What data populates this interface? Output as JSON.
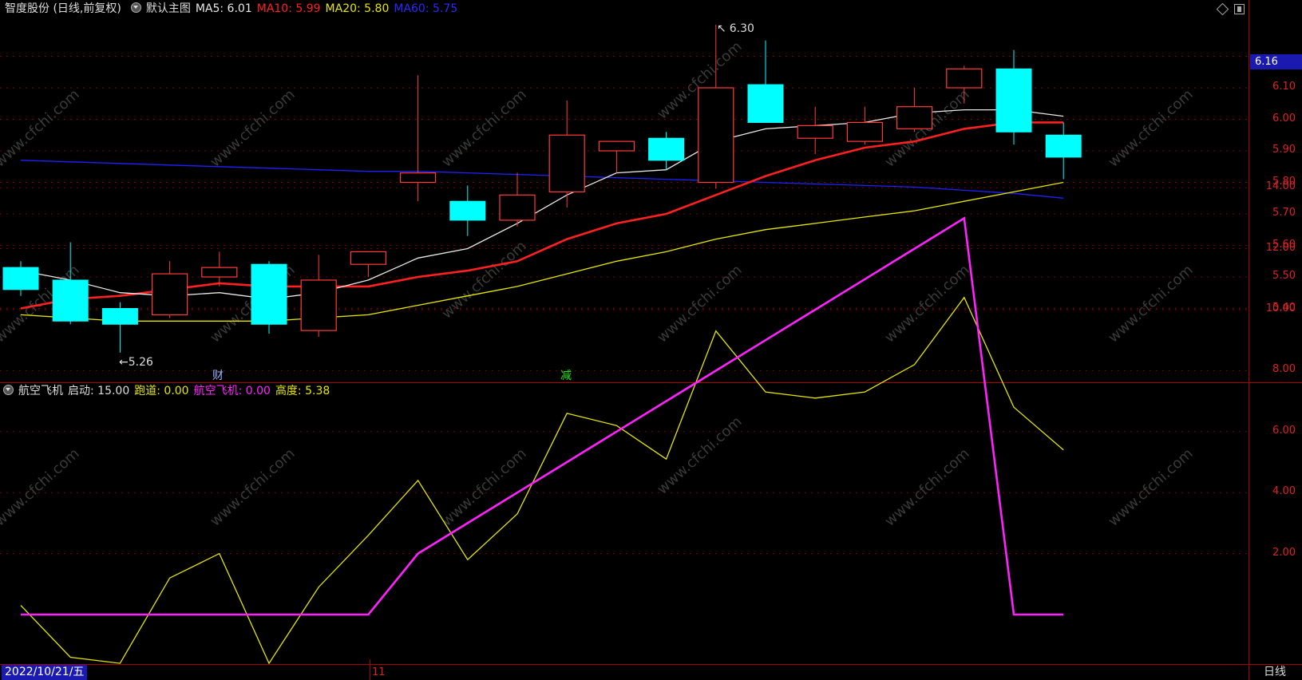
{
  "main_header": {
    "title": "智度股份 (日线,前复权)",
    "indicator_name": "默认主图",
    "ma5": "MA5: 6.01",
    "ma10": "MA10: 5.99",
    "ma20": "MA20: 5.80",
    "ma60": "MA60: 5.75"
  },
  "sub_header": {
    "name": "航空飞机",
    "start": "启动: 15.00",
    "runway": "跑道: 0.00",
    "plane": "航空飞机: 0.00",
    "height": "高度: 5.38"
  },
  "colors": {
    "up": "#ff3b3b",
    "down": "#00ffff",
    "ma5": "#e8e8e8",
    "ma10": "#ff2020",
    "ma20": "#e6e600",
    "ma60": "#2020ff",
    "plane": "#ff22ff",
    "height_line": "#e6e600"
  },
  "price_tag": "6.16",
  "date_label": "2022/10/21/五",
  "month_tick": "11",
  "period_label": "日线",
  "markers": {
    "cai": "财",
    "jian": "减",
    "high_label": "6.30",
    "low_label": "5.26"
  },
  "watermark": "www.cfchi.com",
  "chart_data": [
    {
      "type": "candlestick",
      "ylim": [
        5.2,
        6.25
      ],
      "y_ticks": [
        "6.10",
        "6.00",
        "5.90",
        "5.80",
        "5.70",
        "5.60",
        "5.50",
        "5.40"
      ],
      "candles": [
        {
          "o": 5.53,
          "h": 5.55,
          "l": 5.44,
          "c": 5.46
        },
        {
          "o": 5.49,
          "h": 5.61,
          "l": 5.35,
          "c": 5.36
        },
        {
          "o": 5.4,
          "h": 5.42,
          "l": 5.26,
          "c": 5.35
        },
        {
          "o": 5.38,
          "h": 5.55,
          "l": 5.37,
          "c": 5.51
        },
        {
          "o": 5.5,
          "h": 5.58,
          "l": 5.47,
          "c": 5.53
        },
        {
          "o": 5.54,
          "h": 5.55,
          "l": 5.32,
          "c": 5.35
        },
        {
          "o": 5.33,
          "h": 5.57,
          "l": 5.31,
          "c": 5.49
        },
        {
          "o": 5.54,
          "h": 5.58,
          "l": 5.5,
          "c": 5.58
        },
        {
          "o": 5.8,
          "h": 6.14,
          "l": 5.74,
          "c": 5.83
        },
        {
          "o": 5.74,
          "h": 5.79,
          "l": 5.63,
          "c": 5.68
        },
        {
          "o": 5.68,
          "h": 5.83,
          "l": 5.66,
          "c": 5.76
        },
        {
          "o": 5.77,
          "h": 6.06,
          "l": 5.72,
          "c": 5.95
        },
        {
          "o": 5.9,
          "h": 5.93,
          "l": 5.83,
          "c": 5.93
        },
        {
          "o": 5.94,
          "h": 5.96,
          "l": 5.84,
          "c": 5.87
        },
        {
          "o": 5.8,
          "h": 6.3,
          "l": 5.78,
          "c": 6.1
        },
        {
          "o": 6.11,
          "h": 6.25,
          "l": 5.99,
          "c": 5.99
        },
        {
          "o": 5.94,
          "h": 6.04,
          "l": 5.89,
          "c": 5.98
        },
        {
          "o": 5.93,
          "h": 6.04,
          "l": 5.92,
          "c": 5.99
        },
        {
          "o": 5.97,
          "h": 6.1,
          "l": 5.96,
          "c": 6.04
        },
        {
          "o": 6.1,
          "h": 6.17,
          "l": 6.05,
          "c": 6.16
        },
        {
          "o": 6.16,
          "h": 6.22,
          "l": 5.92,
          "c": 5.96
        },
        {
          "o": 5.95,
          "h": 5.99,
          "l": 5.81,
          "c": 5.88
        }
      ],
      "ma5": [
        5.52,
        5.49,
        5.45,
        5.44,
        5.45,
        5.43,
        5.45,
        5.49,
        5.56,
        5.59,
        5.67,
        5.76,
        5.83,
        5.84,
        5.93,
        5.97,
        5.98,
        5.99,
        6.02,
        6.03,
        6.03,
        6.01
      ],
      "ma10": [
        5.4,
        5.43,
        5.44,
        5.46,
        5.48,
        5.47,
        5.47,
        5.47,
        5.5,
        5.52,
        5.55,
        5.62,
        5.67,
        5.7,
        5.76,
        5.82,
        5.87,
        5.91,
        5.93,
        5.97,
        5.99,
        5.99
      ],
      "ma20": [
        5.38,
        5.37,
        5.36,
        5.36,
        5.36,
        5.36,
        5.37,
        5.38,
        5.41,
        5.44,
        5.47,
        5.51,
        5.55,
        5.58,
        5.62,
        5.65,
        5.67,
        5.69,
        5.71,
        5.74,
        5.77,
        5.8
      ],
      "ma60": [
        5.87,
        5.865,
        5.86,
        5.855,
        5.85,
        5.845,
        5.84,
        5.835,
        5.835,
        5.83,
        5.825,
        5.82,
        5.815,
        5.81,
        5.805,
        5.8,
        5.795,
        5.79,
        5.785,
        5.775,
        5.765,
        5.75
      ]
    },
    {
      "type": "line",
      "ylim": [
        0,
        15
      ],
      "y_ticks": [
        "14.00",
        "12.00",
        "10.00",
        "8.00",
        "6.00",
        "4.00",
        "2.00"
      ],
      "series": [
        {
          "name": "航空飞机",
          "values": [
            0,
            0,
            0,
            0,
            0,
            0,
            0,
            0,
            2,
            3,
            4,
            5,
            6,
            7,
            8,
            9,
            10,
            11,
            12,
            13,
            0,
            0
          ]
        },
        {
          "name": "高度",
          "values": [
            0.3,
            -1.4,
            -1.6,
            1.2,
            2.0,
            -1.6,
            0.9,
            2.6,
            4.4,
            1.8,
            3.3,
            6.6,
            6.2,
            5.1,
            9.3,
            7.3,
            7.1,
            7.3,
            8.2,
            10.4,
            6.8,
            5.4
          ]
        }
      ]
    }
  ]
}
